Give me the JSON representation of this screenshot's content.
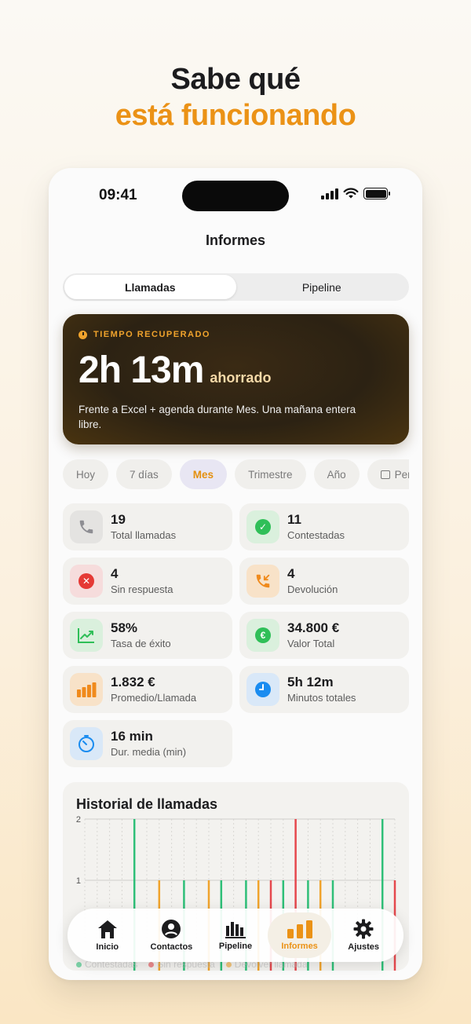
{
  "headline": {
    "line1": "Sabe qué",
    "line2": "está funcionando"
  },
  "status_bar": {
    "time": "09:41"
  },
  "nav": {
    "title": "Informes"
  },
  "segmented": {
    "options": [
      "Llamadas",
      "Pipeline"
    ],
    "selected": 0
  },
  "hero": {
    "tag": "TIEMPO RECUPERADO",
    "value": "2h 13m",
    "suffix": "ahorrado",
    "description": "Frente a Excel + agenda durante Mes. Una mañana entera libre."
  },
  "periods": {
    "items": [
      "Hoy",
      "7 días",
      "Mes",
      "Trimestre",
      "Año",
      "Per"
    ],
    "selected": "Mes"
  },
  "stats": [
    {
      "value": "19",
      "label": "Total llamadas",
      "icon": "phone-icon",
      "color": "#8e8e93",
      "bg": "#e4e3e1"
    },
    {
      "value": "11",
      "label": "Contestadas",
      "icon": "check-circle-icon",
      "color": "#2fbf58",
      "bg": "#daf0dd"
    },
    {
      "value": "4",
      "label": "Sin respuesta",
      "icon": "x-circle-icon",
      "color": "#e53935",
      "bg": "#f6dcdc"
    },
    {
      "value": "4",
      "label": "Devolución",
      "icon": "phone-callback-icon",
      "color": "#f08a1c",
      "bg": "#f8e2c8"
    },
    {
      "value": "58%",
      "label": "Tasa de éxito",
      "icon": "trend-up-icon",
      "color": "#2fbf58",
      "bg": "#daf0dd"
    },
    {
      "value": "34.800 €",
      "label": "Valor Total",
      "icon": "euro-icon",
      "color": "#2fbf58",
      "bg": "#daf0dd"
    },
    {
      "value": "1.832 €",
      "label": "Promedio/Llamada",
      "icon": "bar-chart-icon",
      "color": "#f08a1c",
      "bg": "#f8e2c8"
    },
    {
      "value": "5h 12m",
      "label": "Minutos totales",
      "icon": "clock-icon",
      "color": "#1a8cf0",
      "bg": "#d9e8f8"
    },
    {
      "value": "16 min",
      "label": "Dur. media (min)",
      "icon": "timer-icon",
      "color": "#1a8cf0",
      "bg": "#d9e8f8"
    }
  ],
  "history": {
    "title": "Historial de llamadas",
    "legend": [
      "Contestadas",
      "Sin respuesta",
      "Devolver llamada"
    ]
  },
  "chart_data": {
    "type": "bar",
    "title": "Historial de llamadas",
    "ylim": [
      0,
      2
    ],
    "yticks": [
      1,
      2
    ],
    "grid": true,
    "series_colors": {
      "Contestadas": "#2fbf78",
      "Sin respuesta": "#e5484d",
      "Devolver llamada": "#f0a32c"
    },
    "bars": [
      {
        "slot": 4,
        "series": "Contestadas",
        "value": 2
      },
      {
        "slot": 6,
        "series": "Devolver llamada",
        "value": 1
      },
      {
        "slot": 8,
        "series": "Contestadas",
        "value": 1
      },
      {
        "slot": 10,
        "series": "Devolver llamada",
        "value": 1
      },
      {
        "slot": 11,
        "series": "Contestadas",
        "value": 1
      },
      {
        "slot": 13,
        "series": "Contestadas",
        "value": 1
      },
      {
        "slot": 14,
        "series": "Devolver llamada",
        "value": 1
      },
      {
        "slot": 15,
        "series": "Sin respuesta",
        "value": 1
      },
      {
        "slot": 16,
        "series": "Contestadas",
        "value": 1
      },
      {
        "slot": 17,
        "series": "Sin respuesta",
        "value": 2
      },
      {
        "slot": 18,
        "series": "Contestadas",
        "value": 1
      },
      {
        "slot": 19,
        "series": "Devolver llamada",
        "value": 1
      },
      {
        "slot": 20,
        "series": "Contestadas",
        "value": 1
      },
      {
        "slot": 24,
        "series": "Contestadas",
        "value": 2
      },
      {
        "slot": 25,
        "series": "Sin respuesta",
        "value": 1
      }
    ],
    "slots": 26
  },
  "tabbar": {
    "items": [
      {
        "label": "Inicio",
        "icon": "home-icon"
      },
      {
        "label": "Contactos",
        "icon": "person-icon"
      },
      {
        "label": "Pipeline",
        "icon": "pipeline-icon"
      },
      {
        "label": "Informes",
        "icon": "chart-icon"
      },
      {
        "label": "Ajustes",
        "icon": "gear-icon"
      }
    ],
    "selected": 3
  },
  "colors": {
    "accent": "#eb9216",
    "hero_bg": "#2c2213"
  }
}
